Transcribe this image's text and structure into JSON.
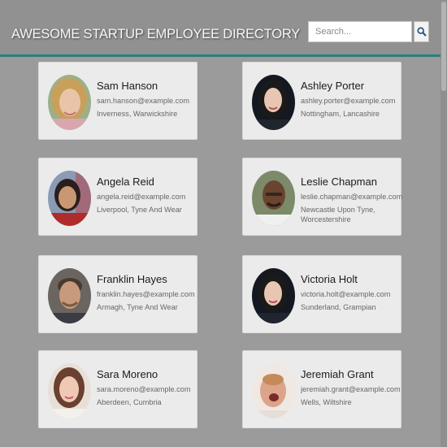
{
  "header": {
    "title": "AWESOME STARTUP EMPLOYEE DIRECTORY",
    "search_placeholder": "Search...",
    "search_icon": "magnifier-icon",
    "accent_color": "#2a7f7a"
  },
  "employees": [
    {
      "name": "Sam Hanson",
      "email": "sam.hanson@example.com",
      "location": "Inverness, Warwickshire"
    },
    {
      "name": "Ashley Porter",
      "email": "ashley.porter@example.com",
      "location": "Nottingham, Lancashire"
    },
    {
      "name": "Angela Reid",
      "email": "angela.reid@example.com",
      "location": "Liverpool, Tyne And Wear"
    },
    {
      "name": "Leslie Chapman",
      "email": "leslie.chapman@example.com",
      "location": "Newcastle Upon Tyne, Worcestershire"
    },
    {
      "name": "Franklin Hayes",
      "email": "franklin.hayes@example.com",
      "location": "Armagh, Tyne And Wear"
    },
    {
      "name": "Victoria Holt",
      "email": "victoria.holt@example.com",
      "location": "Sunderland, Grampian"
    },
    {
      "name": "Sara Moreno",
      "email": "sara.moreno@example.com",
      "location": "Aberdeen, Cumbria"
    },
    {
      "name": "Jeremiah Grant",
      "email": "jeremiah.grant@example.com",
      "location": "Wells, Wiltshire"
    }
  ]
}
